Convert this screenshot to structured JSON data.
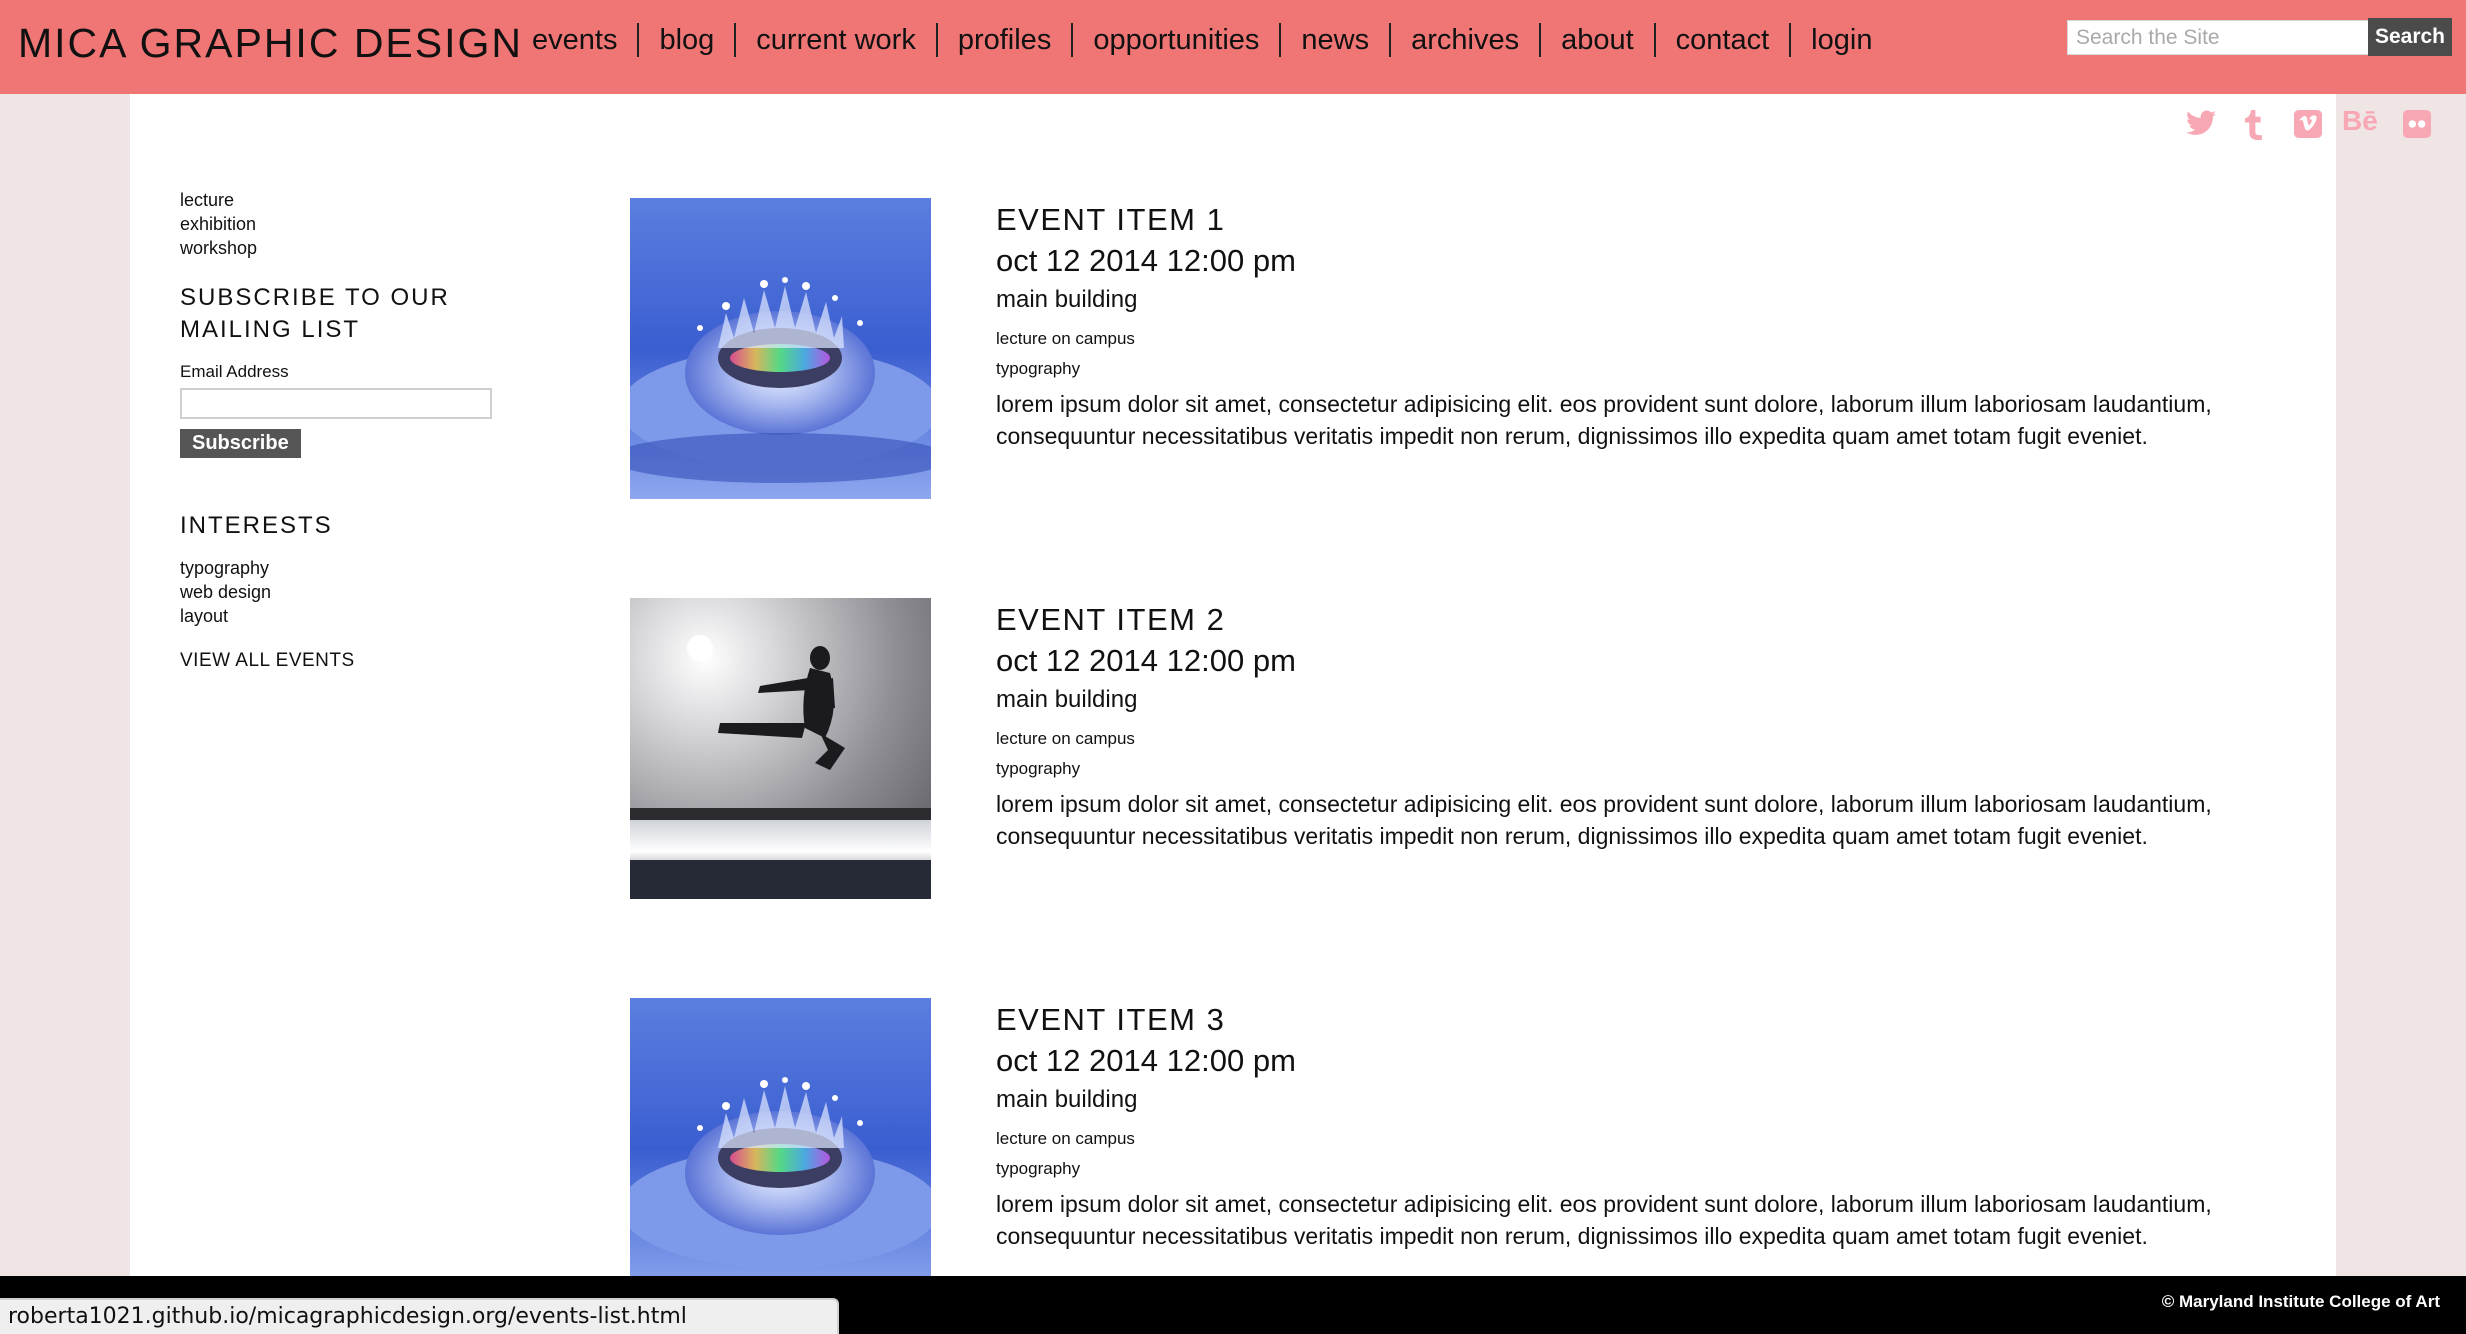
{
  "header": {
    "site_title": "MICA GRAPHIC DESIGN",
    "nav": [
      "events",
      "blog",
      "current work",
      "profiles",
      "opportunities",
      "news",
      "archives",
      "about",
      "contact",
      "login"
    ],
    "search_placeholder": "Search the Site",
    "search_button": "Search"
  },
  "social_icons": [
    "twitter-icon",
    "tumblr-icon",
    "vimeo-icon",
    "behance-icon",
    "flickr-icon"
  ],
  "sidebar": {
    "categories": [
      "lecture",
      "exhibition",
      "workshop"
    ],
    "subscribe_heading_line1": "SUBSCRIBE TO OUR",
    "subscribe_heading_line2": "MAILING LIST",
    "email_label": "Email Address",
    "email_value": "",
    "subscribe_button": "Subscribe",
    "interests_heading": "INTERESTS",
    "interests": [
      "typography",
      "web design",
      "layout"
    ],
    "view_all": "VIEW ALL EVENTS"
  },
  "events": [
    {
      "title": "EVENT ITEM 1",
      "date": "oct 12 2014 12:00 pm",
      "location": "main building",
      "type": "lecture on campus",
      "tag": "typography",
      "image": "water-splash-crown",
      "description": "lorem ipsum dolor sit amet, consectetur adipisicing elit. eos provident sunt dolore, laborum illum laboriosam laudantium, consequuntur necessitatibus veritatis impedit non rerum, dignissimos illo expedita quam amet totam fugit eveniet."
    },
    {
      "title": "EVENT ITEM 2",
      "date": "oct 12 2014 12:00 pm",
      "location": "main building",
      "type": "lecture on campus",
      "tag": "typography",
      "image": "jumping-kick-silhouette",
      "description": "lorem ipsum dolor sit amet, consectetur adipisicing elit. eos provident sunt dolore, laborum illum laboriosam laudantium, consequuntur necessitatibus veritatis impedit non rerum, dignissimos illo expedita quam amet totam fugit eveniet."
    },
    {
      "title": "EVENT ITEM 3",
      "date": "oct 12 2014 12:00 pm",
      "location": "main building",
      "type": "lecture on campus",
      "tag": "typography",
      "image": "water-splash-crown",
      "description": "lorem ipsum dolor sit amet, consectetur adipisicing elit. eos provident sunt dolore, laborum illum laboriosam laudantium, consequuntur necessitatibus veritatis impedit non rerum, dignissimos illo expedita quam amet totam fugit eveniet."
    }
  ],
  "footer": {
    "copyright": "© Maryland Institute College of Art"
  },
  "status_bar": {
    "url": "roberta1021.github.io/micagraphicdesign.org/events-list.html"
  },
  "colors": {
    "header_bg": "#f07676",
    "page_bg": "#efe5e4",
    "social_icon": "#f7a8b4",
    "button_dark": "#4b4b4b"
  }
}
